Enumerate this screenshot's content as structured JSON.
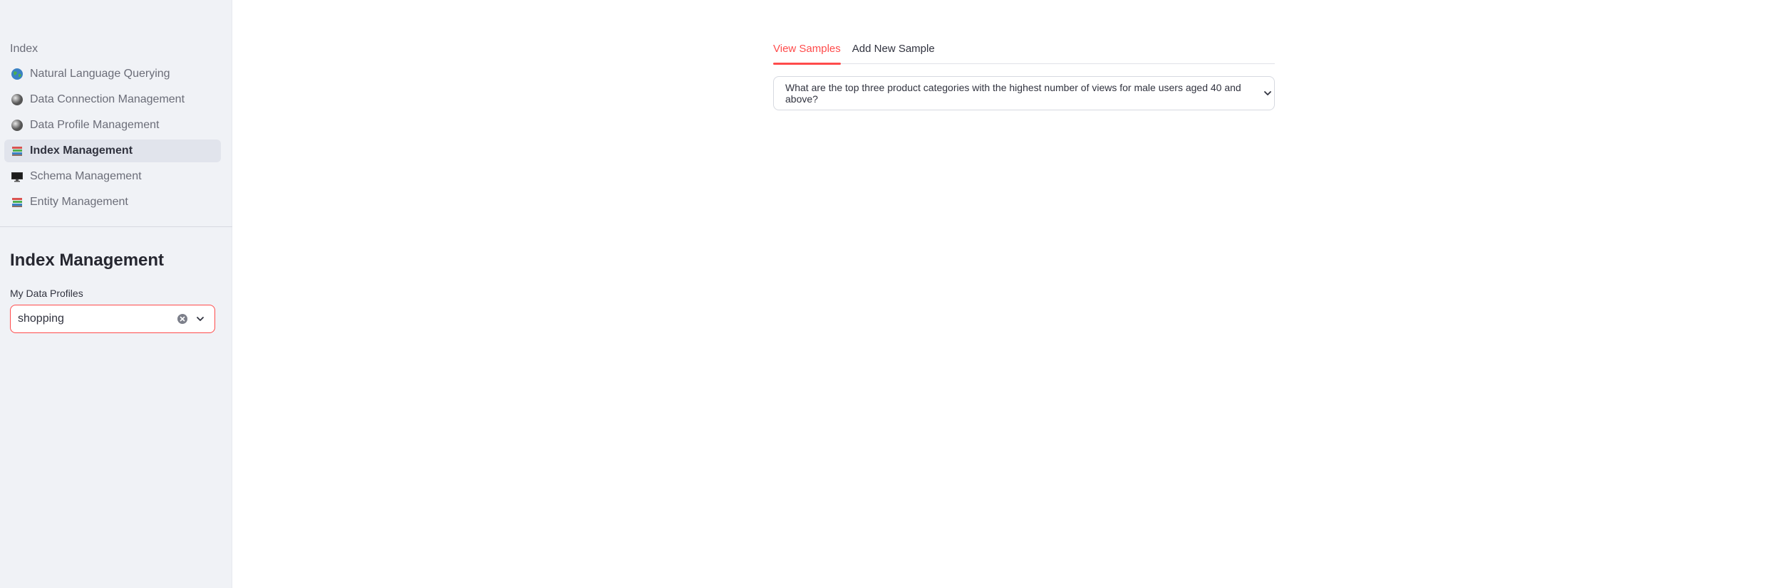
{
  "sidebar": {
    "heading": "Index",
    "items": [
      {
        "label": "Natural Language Querying",
        "icon": "globe-icon",
        "active": false
      },
      {
        "label": "Data Connection Management",
        "icon": "gray-sphere-icon",
        "active": false
      },
      {
        "label": "Data Profile Management",
        "icon": "gray-sphere-icon",
        "active": false
      },
      {
        "label": "Index Management",
        "icon": "books-icon",
        "active": true
      },
      {
        "label": "Schema Management",
        "icon": "monitor-icon",
        "active": false
      },
      {
        "label": "Entity Management",
        "icon": "books-icon",
        "active": false
      }
    ],
    "title": "Index Management",
    "profiles": {
      "label": "My Data Profiles",
      "value": "shopping"
    }
  },
  "main": {
    "tabs": [
      {
        "label": "View Samples",
        "active": true
      },
      {
        "label": "Add New Sample",
        "active": false
      }
    ],
    "expander": {
      "text": "What are the top three product categories with the highest number of views for male users aged 40 and above?"
    }
  },
  "colors": {
    "accent": "#ff4b4b",
    "sidebar_bg": "#f0f2f6",
    "active_item_bg": "#e1e4ec"
  }
}
